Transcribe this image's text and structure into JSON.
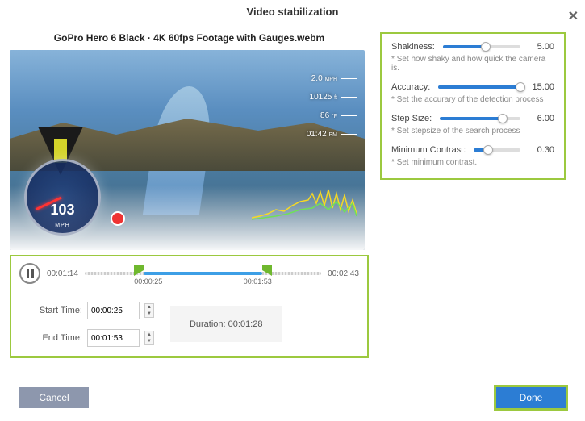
{
  "dialog": {
    "title": "Video stabilization"
  },
  "file": {
    "name": "GoPro Hero 6 Black · 4K 60fps Footage with Gauges.webm"
  },
  "overlay": {
    "speed": "103",
    "speed_unit": "MPH",
    "gauges": [
      {
        "v": "2.0",
        "u": "MPH"
      },
      {
        "v": "10125",
        "u": "ft"
      },
      {
        "v": "86",
        "u": "°F"
      },
      {
        "v": "01:42",
        "u": "PM"
      }
    ]
  },
  "player": {
    "current": "00:01:14",
    "total": "00:02:43",
    "markerA": "00:00:25",
    "markerB": "00:01:53"
  },
  "range": {
    "start_label": "Start Time:",
    "start": "00:00:25",
    "end_label": "End Time:",
    "end": "00:01:53",
    "duration_label": "Duration:",
    "duration": "00:01:28"
  },
  "params": {
    "shakiness": {
      "label": "Shakiness:",
      "value": "5.00",
      "hint": "* Set how shaky and how quick the camera is.",
      "pct": 55
    },
    "accuracy": {
      "label": "Accuracy:",
      "value": "15.00",
      "hint": "* Set the accurary of the detection process",
      "pct": 100
    },
    "stepsize": {
      "label": "Step Size:",
      "value": "6.00",
      "hint": "* Set stepsize of the search process",
      "pct": 78
    },
    "contrast": {
      "label": "Minimum Contrast:",
      "value": "0.30",
      "hint": "* Set minimum contrast.",
      "pct": 30
    }
  },
  "buttons": {
    "cancel": "Cancel",
    "done": "Done"
  }
}
